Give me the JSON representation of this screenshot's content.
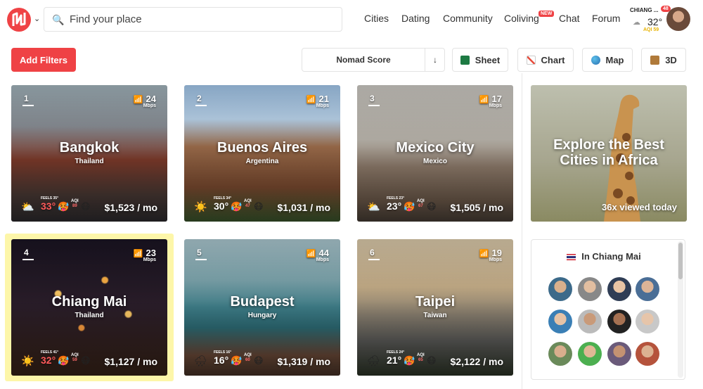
{
  "header": {
    "search_placeholder": "Find your place",
    "nav": [
      "Cities",
      "Dating",
      "Community",
      "Coliving",
      "Chat",
      "Forum"
    ],
    "new_badge": "NEW",
    "user_location": "CHIANG ...",
    "user_temp": "32°",
    "user_aqi": "AQI 59",
    "notifications": "48"
  },
  "toolbar": {
    "add_filters": "Add Filters",
    "sort_label": "Nomad Score",
    "sort_dir": "↓",
    "tools": [
      "Sheet",
      "Chart",
      "Map",
      "3D"
    ]
  },
  "cards": [
    {
      "rank": "1",
      "city": "Bangkok",
      "country": "Thailand",
      "wifi": "24",
      "wifi_unit": "Mbps",
      "feels": "FEELS 35°",
      "temp": "33°",
      "aqi": "89",
      "cost": "$1,523 / mo"
    },
    {
      "rank": "2",
      "city": "Buenos Aires",
      "country": "Argentina",
      "wifi": "21",
      "wifi_unit": "Mbps",
      "feels": "FEELS 34°",
      "temp": "30°",
      "aqi": "47",
      "cost": "$1,031 / mo"
    },
    {
      "rank": "3",
      "city": "Mexico City",
      "country": "Mexico",
      "wifi": "17",
      "wifi_unit": "Mbps",
      "feels": "FEELS 23°",
      "temp": "23°",
      "aqi": "67",
      "cost": "$1,505 / mo"
    },
    {
      "rank": "4",
      "city": "Chiang Mai",
      "country": "Thailand",
      "wifi": "23",
      "wifi_unit": "Mbps",
      "feels": "FEELS 41°",
      "temp": "32°",
      "aqi": "59",
      "cost": "$1,127 / mo"
    },
    {
      "rank": "5",
      "city": "Budapest",
      "country": "Hungary",
      "wifi": "44",
      "wifi_unit": "Mbps",
      "feels": "FEELS 16°",
      "temp": "16°",
      "aqi": "60",
      "cost": "$1,319 / mo"
    },
    {
      "rank": "6",
      "city": "Taipei",
      "country": "Taiwan",
      "wifi": "19",
      "wifi_unit": "Mbps",
      "feels": "FEELS 24°",
      "temp": "21°",
      "aqi": "65",
      "cost": "$2,122 / mo"
    }
  ],
  "promo": {
    "title": "Explore the Best Cities in Africa",
    "views": "36x viewed today"
  },
  "people": {
    "title": "In Chiang Mai"
  }
}
